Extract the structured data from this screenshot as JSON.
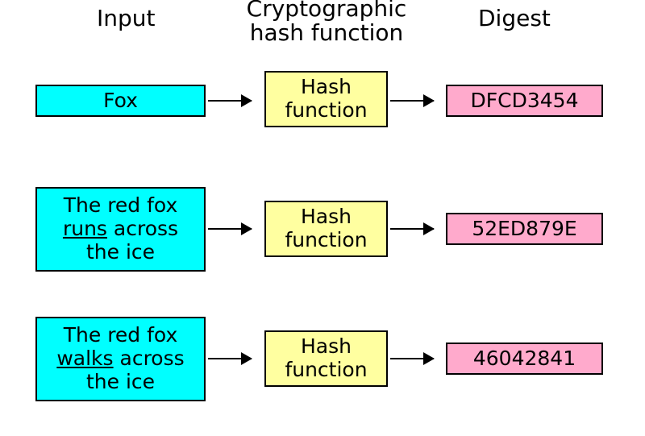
{
  "headers": {
    "input": "Input",
    "hash": "Cryptographic",
    "hash2": "hash function",
    "digest": "Digest"
  },
  "rows": [
    {
      "input_pre": "",
      "input_key": "Fox",
      "input_post": "",
      "hash_l1": "Hash",
      "hash_l2": "function",
      "digest": "DFCD3454"
    },
    {
      "input_pre": "The red fox",
      "input_key": "runs",
      "input_post": " across",
      "input_l3": "the ice",
      "hash_l1": "Hash",
      "hash_l2": "function",
      "digest": "52ED879E"
    },
    {
      "input_pre": "The red fox",
      "input_key": "walks",
      "input_post": " across",
      "input_l3": "the ice",
      "hash_l1": "Hash",
      "hash_l2": "function",
      "digest": "46042841"
    }
  ],
  "colors": {
    "input": "#00FFFF",
    "hash": "#FFFFA0",
    "digest": "#FFAACC"
  }
}
